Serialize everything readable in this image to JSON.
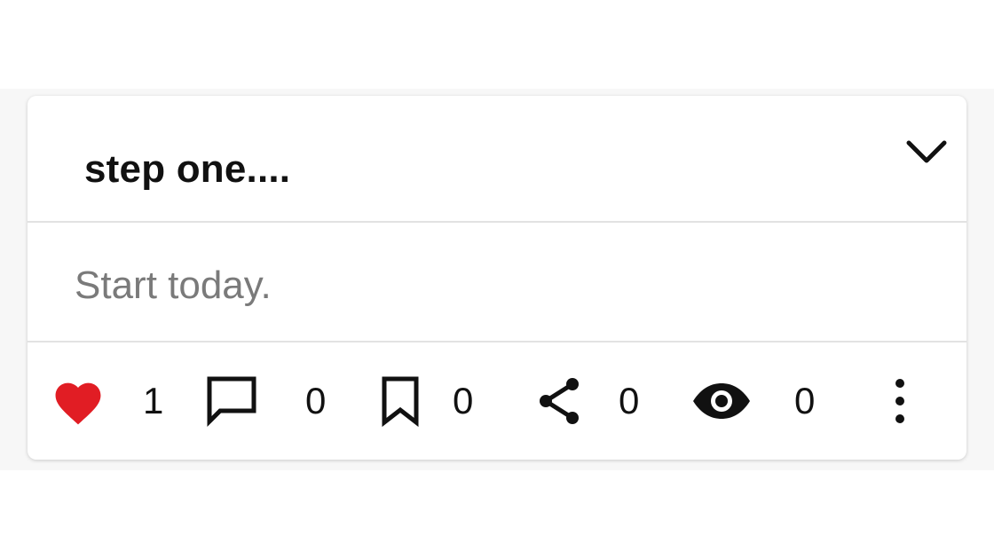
{
  "post": {
    "title": "step one....",
    "body": "Start today."
  },
  "actions": {
    "like_count": "1",
    "comment_count": "0",
    "bookmark_count": "0",
    "share_count": "0",
    "view_count": "0"
  },
  "icons": {
    "collapse": "chevron-down-icon",
    "like": "heart-icon",
    "comment": "comment-icon",
    "bookmark": "bookmark-icon",
    "share": "share-icon",
    "view": "eye-icon",
    "more": "more-vertical-icon"
  },
  "colors": {
    "like_active": "#e11d24",
    "icon": "#111111",
    "body_text": "#7a7a7a"
  }
}
